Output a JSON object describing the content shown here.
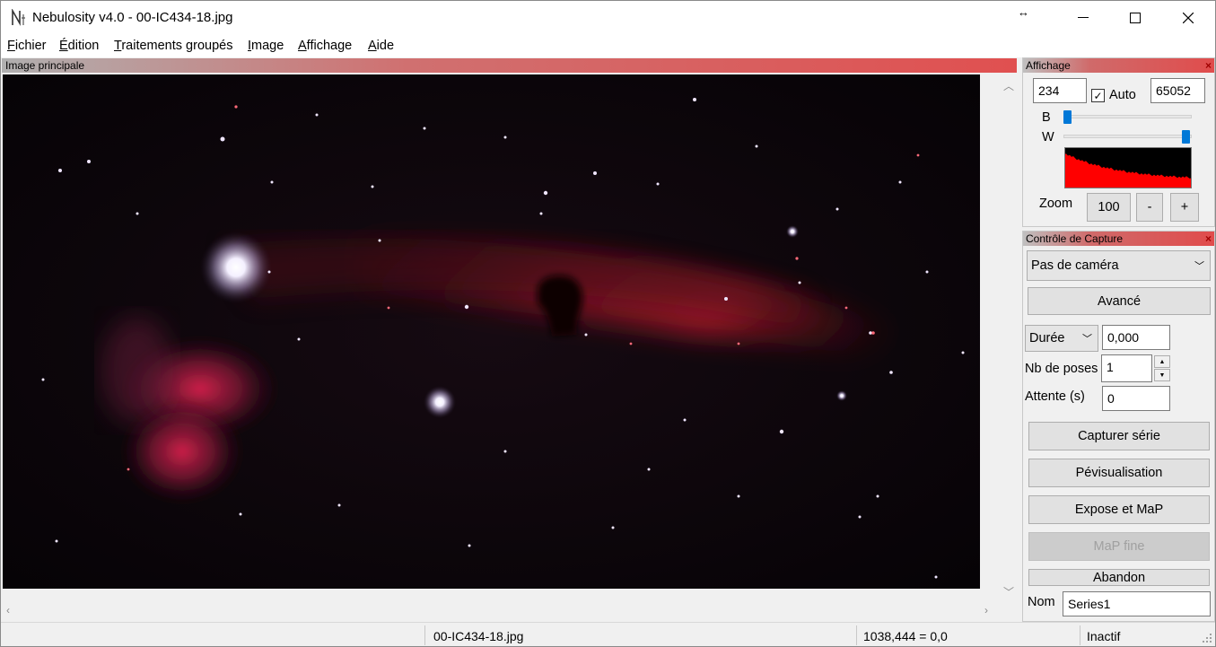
{
  "window": {
    "title": "Nebulosity v4.0 - 00-IC434-18.jpg",
    "resize_glyph": "↔",
    "minimize": "—",
    "maximize": "☐",
    "close": "✕"
  },
  "menu": [
    {
      "ul": "F",
      "rest": "ichier"
    },
    {
      "ul": "É",
      "rest": "dition"
    },
    {
      "ul": "T",
      "rest": "raitements groupés"
    },
    {
      "ul": "I",
      "rest": "mage"
    },
    {
      "ul": "A",
      "rest": "ffichage"
    },
    {
      "ul": "A",
      "rest": "ide"
    }
  ],
  "main_image": {
    "caption": "Image principale",
    "subject": "Horsehead and Flame nebula astrophoto"
  },
  "affichage": {
    "caption": "Affichage",
    "close": "×",
    "black_value": "234",
    "auto_label": "Auto",
    "auto_checked": "✓",
    "white_value": "65052",
    "b_label": "B",
    "w_label": "W",
    "b_level": 0.03,
    "w_level": 0.95,
    "zoom_label": "Zoom",
    "zoom_value": "100",
    "zoom_minus": "-",
    "zoom_plus": "+",
    "histogram_color": "#ff0000"
  },
  "capture": {
    "caption": "Contrôle de Capture",
    "close": "×",
    "camera": "Pas de caméra",
    "avance": "Avancé",
    "duree_mode": "Durée",
    "duree_value": "0,000",
    "nb_poses_label": "Nb de poses",
    "nb_poses_value": "1",
    "attente_label": "Attente (s)",
    "attente_value": "0",
    "capturer_serie": "Capturer série",
    "previsualisation": "Pévisualisation",
    "expose_map": "Expose et MaP",
    "map_fine": "MaP fine",
    "abandon": "Abandon",
    "nom_label": "Nom",
    "nom_value": "Series1"
  },
  "status": {
    "file": "00-IC434-18.jpg",
    "coords": "1038,444 = 0,0",
    "state": "Inactif"
  },
  "colors": {
    "caption_red": "#e05050",
    "accent": "#0078d7"
  }
}
